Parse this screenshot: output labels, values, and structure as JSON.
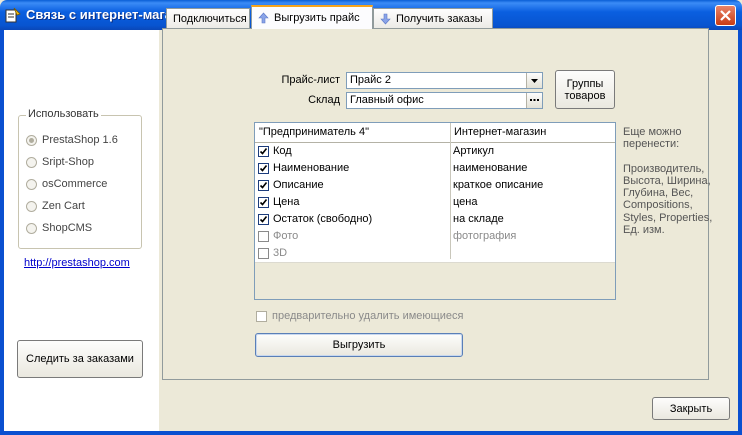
{
  "window": {
    "title": "Связь с интернет-магазином",
    "close_icon": "close-icon"
  },
  "left_panel": {
    "group_title": "Использовать",
    "options": [
      {
        "label": "PrestaShop 1.6",
        "checked": true
      },
      {
        "label": "Sript-Shop",
        "checked": false
      },
      {
        "label": "osCommerce",
        "checked": false
      },
      {
        "label": "Zen Cart",
        "checked": false
      },
      {
        "label": "ShopCMS",
        "checked": false
      }
    ],
    "link": "http://prestashop.com",
    "track_button": "Следить за заказами"
  },
  "tabs": [
    {
      "label": "Подключиться",
      "icon": "none",
      "active": false
    },
    {
      "label": "Выгрузить прайс",
      "icon": "arrow-up-icon",
      "active": true
    },
    {
      "label": "Получить заказы",
      "icon": "arrow-down-icon",
      "active": false
    }
  ],
  "form": {
    "price_label": "Прайс-лист",
    "price_value": "Прайс 2",
    "warehouse_label": "Склад",
    "warehouse_value": "Главный офис",
    "groups_button_line1": "Группы",
    "groups_button_line2": "товаров"
  },
  "mapping_table": {
    "headers": [
      "\"Предприниматель 4\"",
      "Интернет-магазин"
    ],
    "rows": [
      {
        "source": "Код",
        "target": "Артикул",
        "checked": true,
        "enabled": true
      },
      {
        "source": "Наименование",
        "target": "наименование",
        "checked": true,
        "enabled": true
      },
      {
        "source": "Описание",
        "target": "краткое описание",
        "checked": true,
        "enabled": true
      },
      {
        "source": "Цена",
        "target": "цена",
        "checked": true,
        "enabled": true
      },
      {
        "source": "Остаток (свободно)",
        "target": "на складе",
        "checked": true,
        "enabled": true
      },
      {
        "source": "Фото",
        "target": "фотография",
        "checked": false,
        "enabled": false
      },
      {
        "source": "3D",
        "target": "",
        "checked": false,
        "enabled": false
      }
    ]
  },
  "side_note": {
    "line1": "Еще можно",
    "line2": "перенести:",
    "line3": "Производитель,",
    "line4": "Высота, Ширина,",
    "line5": "Глубина, Вес,",
    "line6": "Compositions,",
    "line7": "Styles, Properties,",
    "line8": "Ед. изм."
  },
  "delete_existing": {
    "label": "предварительно удалить имеющиеся",
    "checked": false
  },
  "export_button": "Выгрузить",
  "close_button": "Закрыть",
  "colors": {
    "title_bar": "#0a5fe0",
    "tab_highlight": "#f6a41c",
    "dialog_bg": "#ece9d8",
    "link": "#0000cc"
  }
}
